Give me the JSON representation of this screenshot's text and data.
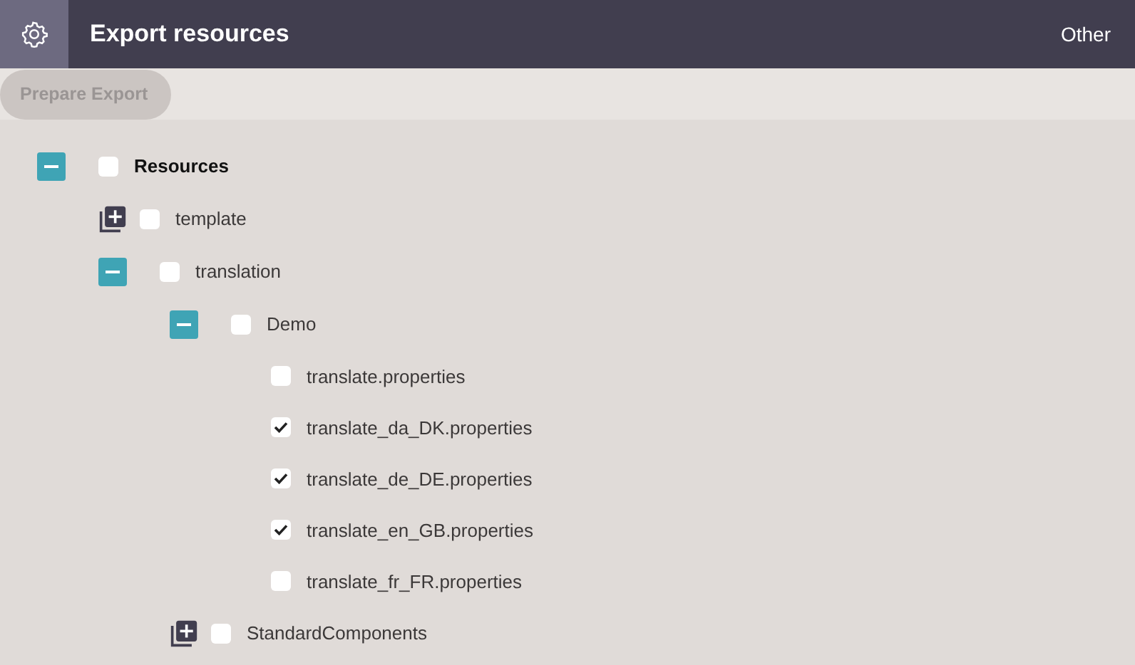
{
  "header": {
    "title": "Export resources",
    "menu": "Other"
  },
  "toolbar": {
    "button": {
      "label": "Prepare Export",
      "disabled": true
    }
  },
  "tree": [
    {
      "label": "Resources",
      "checked": false,
      "expanded": true,
      "children": [
        {
          "label": "template",
          "checked": false,
          "expanded": false
        },
        {
          "label": "translation",
          "checked": false,
          "expanded": true,
          "children": [
            {
              "label": "Demo",
              "checked": false,
              "expanded": true,
              "children": [
                {
                  "label": "translate.properties",
                  "checked": false
                },
                {
                  "label": "translate_da_DK.properties",
                  "checked": true
                },
                {
                  "label": "translate_de_DE.properties",
                  "checked": true
                },
                {
                  "label": "translate_en_GB.properties",
                  "checked": true
                },
                {
                  "label": "translate_fr_FR.properties",
                  "checked": false
                }
              ]
            },
            {
              "label": "StandardComponents",
              "checked": false,
              "expanded": false
            }
          ]
        }
      ]
    }
  ]
}
